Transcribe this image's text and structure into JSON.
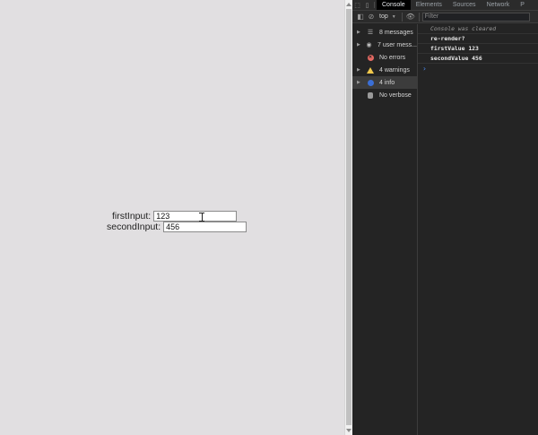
{
  "page": {
    "first_label": "firstInput:",
    "first_value": "123",
    "second_label": "secondInput:",
    "second_value": "456"
  },
  "devtools": {
    "tabs": [
      "Console",
      "Elements",
      "Sources",
      "Network",
      "P"
    ],
    "active_tab": "Console",
    "context": "top",
    "filter_placeholder": "Filter",
    "sidebar": [
      {
        "icon": "list-icon",
        "label": "8 messages"
      },
      {
        "icon": "user-icon",
        "label": "7 user mess..."
      },
      {
        "icon": "error-icon",
        "label": "No errors"
      },
      {
        "icon": "warning-icon",
        "label": "4 warnings"
      },
      {
        "icon": "info-icon",
        "label": "4 info"
      },
      {
        "icon": "verbose-icon",
        "label": "No verbose"
      }
    ],
    "console_messages": [
      "Console was cleared",
      "re-render?",
      "firstValue 123",
      "secondValue 456"
    ],
    "prompt_symbol": "›"
  },
  "colors": {
    "page_bg": "#e1dfe1",
    "devtools_bg": "#242424",
    "info_blue": "#3b6fd6",
    "warning_yellow": "#f2c94c",
    "error_red": "#e46962"
  }
}
